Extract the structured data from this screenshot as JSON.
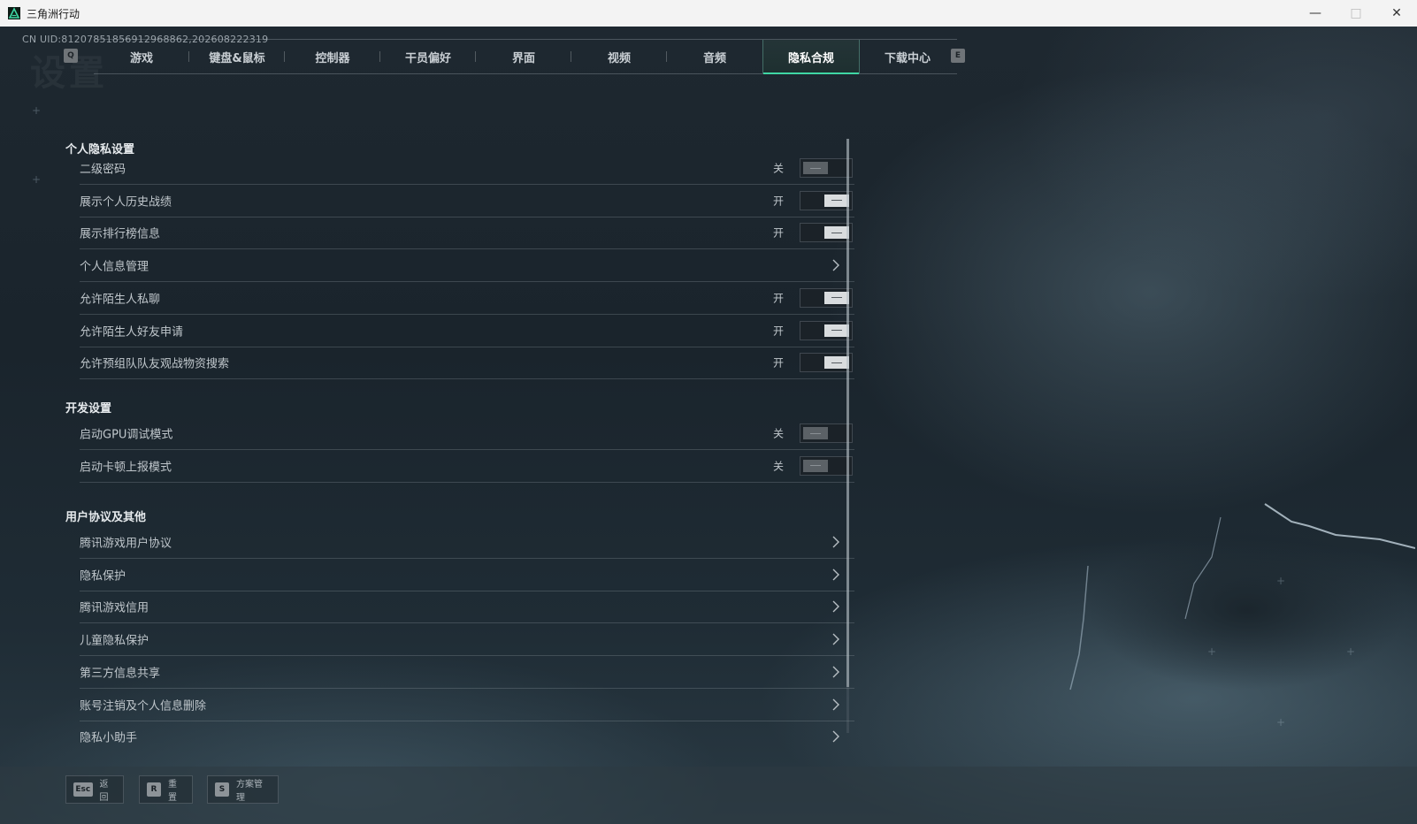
{
  "window": {
    "title": "三角洲行动",
    "minimize_icon": "minimize-icon",
    "maximize_icon": "maximize-icon",
    "close_icon": "close-icon"
  },
  "header": {
    "uid": "CN UID:8120785185691296886​2,202608222319",
    "bg_title": "设置"
  },
  "tabs": {
    "prev_key": "Q",
    "next_key": "E",
    "items": [
      {
        "label": "游戏"
      },
      {
        "label": "键盘&鼠标"
      },
      {
        "label": "控制器"
      },
      {
        "label": "干员偏好"
      },
      {
        "label": "界面"
      },
      {
        "label": "视频"
      },
      {
        "label": "音频"
      },
      {
        "label": "隐私合规",
        "active": true
      },
      {
        "label": "下载中心"
      }
    ]
  },
  "sections": {
    "privacy": {
      "title": "个人隐私设置",
      "rows": [
        {
          "label": "二级密码",
          "state": "关",
          "on": false
        },
        {
          "label": "展示个人历史战绩",
          "state": "开",
          "on": true
        },
        {
          "label": "展示排行榜信息",
          "state": "开",
          "on": true
        },
        {
          "label": "个人信息管理"
        },
        {
          "label": "允许陌生人私聊",
          "state": "开",
          "on": true
        },
        {
          "label": "允许陌生人好友申请",
          "state": "开",
          "on": true
        },
        {
          "label": "允许预组队队友观战物资搜索",
          "state": "开",
          "on": true
        }
      ]
    },
    "dev": {
      "title": "开发设置",
      "rows": [
        {
          "label": "启动GPU调试模式",
          "state": "关",
          "on": false
        },
        {
          "label": "启动卡顿上报模式",
          "state": "关",
          "on": false
        }
      ]
    },
    "agreements": {
      "title": "用户协议及其他",
      "rows": [
        {
          "label": "腾讯游戏用户协议"
        },
        {
          "label": "隐私保护"
        },
        {
          "label": "腾讯游戏信用"
        },
        {
          "label": "儿童隐私保护"
        },
        {
          "label": "第三方信息共享"
        },
        {
          "label": "账号注销及个人信息删除"
        },
        {
          "label": "隐私小助手"
        }
      ]
    }
  },
  "footer": {
    "back": {
      "key": "Esc",
      "label": "返回"
    },
    "reset": {
      "key": "R",
      "label": "重置"
    },
    "scheme": {
      "key": "S",
      "label": "方案管理"
    }
  },
  "colors": {
    "accent": "#3fd7a4",
    "background": "#1a242c",
    "text": "#c0c7cc"
  }
}
